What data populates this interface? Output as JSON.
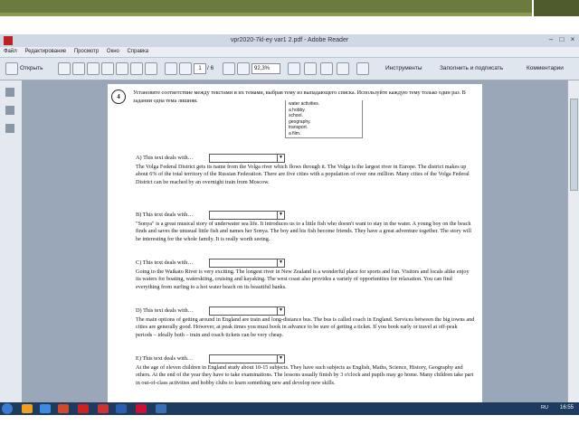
{
  "window": {
    "title": "vpr2020-7kl-ey var1 2.pdf - Adobe Reader"
  },
  "menu": [
    "Файл",
    "Редактирование",
    "Просмотр",
    "Окно",
    "Справка"
  ],
  "toolbar": {
    "open_label": "Открыть",
    "page_current": "1",
    "page_total": "/ 6",
    "zoom": "92,3%",
    "tools_label": "Инструменты",
    "fill_sign_label": "Заполнить и подписать",
    "comments_label": "Комментарии"
  },
  "page": {
    "task_number": "4",
    "instruction": "Установите соответствие между текстами и их темами, выбрав тему из выпадающего списка. Используйте каждую тему только один раз. В задании одна тема лишняя.",
    "topics": [
      "water activities.",
      "a hobby.",
      "school.",
      "geography.",
      "transport.",
      "a film."
    ],
    "sections": [
      {
        "question": "A) This text deals with…",
        "text": "The Volga Federal District gets its name from the Volga river which flows through it. The Volga is the largest river in Europe. The district makes up about 6% of the total territory of the Russian Federation. There are five cities with a population of over one million. Many cities of the Volga Federal District can be reached by an overnight train from Moscow."
      },
      {
        "question": "B) This text deals with…",
        "text": "\"Sonya\" is a great musical story of underwater sea life. It introduces us to a little fish who doesn't want to stay in the water. A young boy on the beach finds and saves the unusual little fish and names her Sonya. The boy and his fish become friends. They have a great adventure together. The story will be interesting for the whole family. It is really worth seeing."
      },
      {
        "question": "C) This text deals with…",
        "text": "Going to the Waikato River is very exciting. The longest river in New Zealand is a wonderful place for sports and fun. Visitors and locals alike enjoy its waters for boating, waterskiing, cruising and kayaking. The west coast also provides a variety of opportunities for relaxation. You can find everything from surfing to a hot water beach on its beautiful banks."
      },
      {
        "question": "D) This text deals with…",
        "text": "The main options of getting around in England are train and long-distance bus. The bus is called coach in England. Services between the big towns and cities are generally good. However, at peak times you must book in advance to be sure of getting a ticket. If you book early or travel at off-peak periods – ideally both – train and coach tickets can be very cheap."
      },
      {
        "question": "E) This text deals with…",
        "text": "At the age of eleven children in England study about 10-15 subjects. They have such subjects as English, Maths, Science, History, Geography and others. At the end of the year they have to take examinations. The lessons usually finish by 3 o'clock and pupils may go home. Many children take part in out-of-class activities and hobby clubs to learn something new and develop new skills."
      }
    ]
  },
  "taskbar": {
    "lang": "RU",
    "time": "16:55"
  },
  "colors": {
    "slide_green": "#6b7a3f",
    "window_bg": "#b7c5d6",
    "taskbar": "#1e3b5f"
  }
}
